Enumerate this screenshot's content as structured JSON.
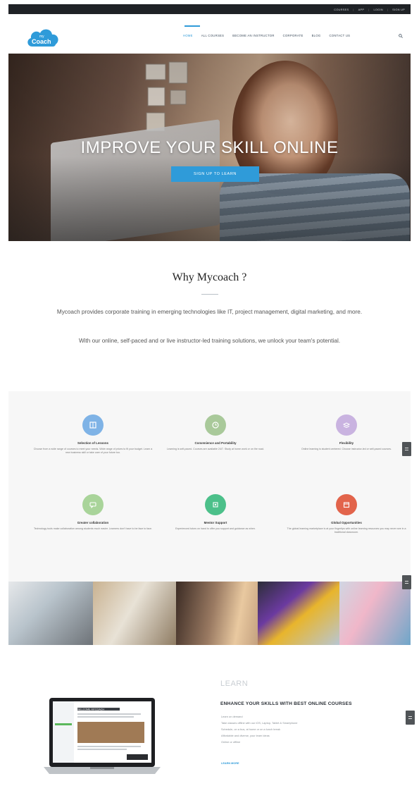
{
  "topbar": {
    "links": [
      "COURSES",
      "APP",
      "LOGIN",
      "SIGN UP"
    ]
  },
  "header": {
    "logo_text": "Coach",
    "nav": [
      "HOME",
      "ALL COURSES",
      "BECOME AN INSTRUCTOR",
      "CORPORATE",
      "BLOG",
      "CONTACT US"
    ],
    "active_nav": "HOME",
    "accent_color": "#2f9bd9"
  },
  "hero": {
    "title": "IMPROVE YOUR SKILL ONLINE",
    "button": "SIGN UP TO LEARN"
  },
  "why": {
    "title": "Why Mycoach ?",
    "paragraph1": "Mycoach provides corporate training in emerging technologies like IT, project management, digital marketing, and more.",
    "paragraph2": "With our online, self-paced and or live instructor-led training solutions, we unlock your team's potential."
  },
  "features": [
    {
      "title": "Selection of Lessons",
      "desc": "Choose from a wide range of courses to meet your needs. Wide range of prices to fit your budget. Learn a new business skill or take care of your future too.",
      "color": "#7fb3e6",
      "icon": "book-icon"
    },
    {
      "title": "Convenience and Portability",
      "desc": "Learning is self-paced. Courses are available 24/7. Study at home work or on the road.",
      "color": "#a9c99a",
      "icon": "clock-icon"
    },
    {
      "title": "Flexibility",
      "desc": "Online learning is student centered. Choose instructor-led or self-paced courses.",
      "color": "#c9b3e0",
      "icon": "layers-icon"
    },
    {
      "title": "Greater collaboration",
      "desc": "Technology tools make collaboration among students much easier. Learners don't have to be face to face.",
      "color": "#a9d49a",
      "icon": "chat-icon"
    },
    {
      "title": "Mentor Support",
      "desc": "Experienced tutors on hand to offer you support and guidance as when.",
      "color": "#4cc08a",
      "icon": "mentor-icon"
    },
    {
      "title": "Global Opportunities",
      "desc": "The global learning marketplace is at your fingertips with online learning resources you may never see in a traditional classroom.",
      "color": "#e2644b",
      "icon": "calendar-icon"
    }
  ],
  "learn": {
    "kicker": "LEARN",
    "title": "ENHANCE YOUR SKILLS WITH BEST ONLINE COURSES",
    "items": [
      "Learn on demand",
      "Take classes offline with our iOS, Laptop, Tablet & Smartphone",
      "Schedule, on a bus, at home or on a lunch break",
      "Affordable and diverse, your learn ideas",
      "Online or offline"
    ],
    "link": "LEARN MORE",
    "laptop_screen_title": "WELCOME MYCOACH"
  }
}
